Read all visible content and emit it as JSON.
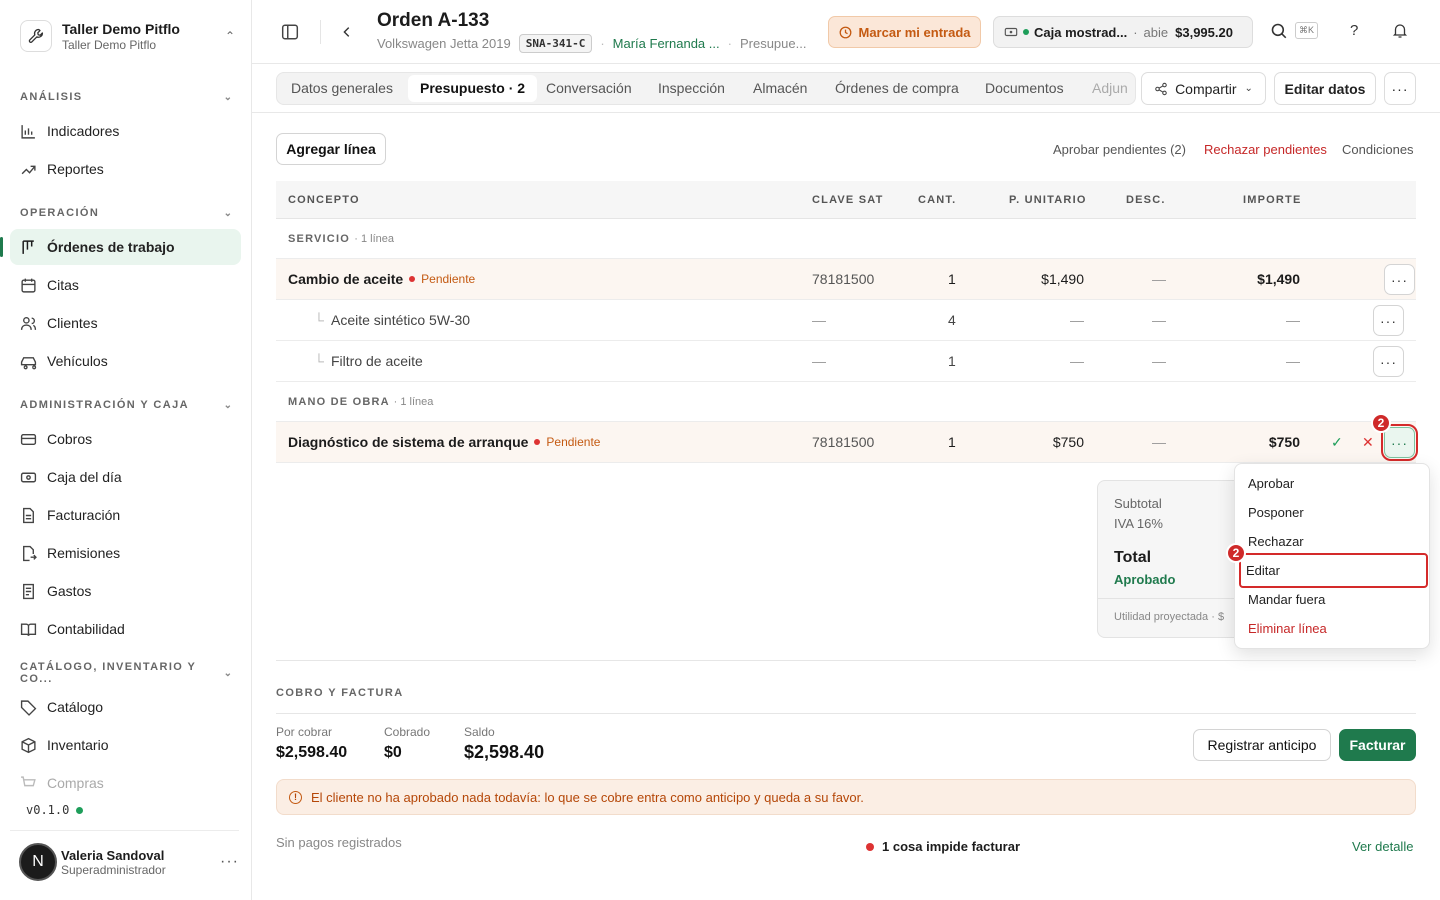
{
  "workspace": {
    "name": "Taller Demo Pitflo",
    "subtitle": "Taller Demo Pitflo"
  },
  "sidebar": {
    "sections": [
      {
        "label": "ANÁLISIS"
      },
      {
        "label": "OPERACIÓN"
      },
      {
        "label": "ADMINISTRACIÓN Y CAJA"
      },
      {
        "label": "CATÁLOGO, INVENTARIO Y CO..."
      }
    ],
    "items": [
      {
        "label": "Indicadores"
      },
      {
        "label": "Reportes"
      },
      {
        "label": "Órdenes de trabajo"
      },
      {
        "label": "Citas"
      },
      {
        "label": "Clientes"
      },
      {
        "label": "Vehículos"
      },
      {
        "label": "Cobros"
      },
      {
        "label": "Caja del día"
      },
      {
        "label": "Facturación"
      },
      {
        "label": "Remisiones"
      },
      {
        "label": "Gastos"
      },
      {
        "label": "Contabilidad"
      },
      {
        "label": "Catálogo"
      },
      {
        "label": "Inventario"
      },
      {
        "label": "Compras"
      }
    ],
    "version": "v0.1.0",
    "user": {
      "initial": "N",
      "name": "Valeria Sandoval",
      "role": "Superadministrador"
    }
  },
  "header": {
    "title": "Orden A-133",
    "vehicle": "Volkswagen Jetta 2019",
    "plate": "SNA-341-C",
    "customer": "María Fernanda ...",
    "status": "Presupue...",
    "entrada_label": "Marcar mi entrada",
    "caja": {
      "name": "Caja mostrad...",
      "state": "abie",
      "amount": "$3,995.20"
    },
    "shortcut": "⌘K"
  },
  "tabs": [
    {
      "label": "Datos generales"
    },
    {
      "label": "Presupuesto · 2"
    },
    {
      "label": "Conversación"
    },
    {
      "label": "Inspección"
    },
    {
      "label": "Almacén"
    },
    {
      "label": "Órdenes de compra"
    },
    {
      "label": "Documentos"
    },
    {
      "label": "Adjun"
    }
  ],
  "actions": {
    "share": "Compartir",
    "edit": "Editar datos"
  },
  "toolbar": {
    "add_line": "Agregar línea",
    "approve_pending": "Aprobar pendientes (2)",
    "reject_pending": "Rechazar pendientes",
    "conditions": "Condiciones"
  },
  "table": {
    "columns": [
      "CONCEPTO",
      "CLAVE SAT",
      "CANT.",
      "P. UNITARIO",
      "DESC.",
      "IMPORTE"
    ],
    "groups": [
      {
        "label": "SERVICIO",
        "count": "· 1 línea",
        "main": {
          "name": "Cambio de aceite",
          "status": "Pendiente",
          "sat": "78181500",
          "qty": "1",
          "unit": "$1,490",
          "desc": "—",
          "amount": "$1,490"
        },
        "subs": [
          {
            "name": "Aceite sintético 5W-30",
            "sat": "—",
            "qty": "4",
            "unit": "—",
            "desc": "—",
            "amount": "—"
          },
          {
            "name": "Filtro de aceite",
            "sat": "—",
            "qty": "1",
            "unit": "—",
            "desc": "—",
            "amount": "—"
          }
        ]
      },
      {
        "label": "MANO DE OBRA",
        "count": "· 1 línea",
        "main": {
          "name": "Diagnóstico de sistema de arranque",
          "status": "Pendiente",
          "sat": "78181500",
          "qty": "1",
          "unit": "$750",
          "desc": "—",
          "amount": "$750"
        }
      }
    ]
  },
  "totals": {
    "subtotal_label": "Subtotal",
    "iva_label": "IVA 16%",
    "total_label": "Total",
    "approved_label": "Aprobado",
    "utilidad_label": "Utilidad proyectada · $"
  },
  "menu": {
    "items": [
      "Aprobar",
      "Posponer",
      "Rechazar",
      "Editar",
      "Mandar fuera",
      "Eliminar línea"
    ],
    "selected": "Editar"
  },
  "step_badge": "2",
  "cobro": {
    "section_label": "COBRO Y FACTURA",
    "por_cobrar_label": "Por cobrar",
    "por_cobrar": "$2,598.40",
    "cobrado_label": "Cobrado",
    "cobrado": "$0",
    "saldo_label": "Saldo",
    "saldo": "$2,598.40",
    "anticipo_btn": "Registrar anticipo",
    "facturar_btn": "Facturar",
    "alert": "El cliente no ha aprobado nada todavía: lo que se cobre entra como anticipo y queda a su favor.",
    "no_payments": "Sin pagos registrados",
    "blockers": "1 cosa impide facturar",
    "detail_link": "Ver detalle"
  },
  "colors": {
    "accent": "#1f7a4d",
    "warning": "#c45a12",
    "danger": "#c62828",
    "highlight": "#d42a2a"
  }
}
